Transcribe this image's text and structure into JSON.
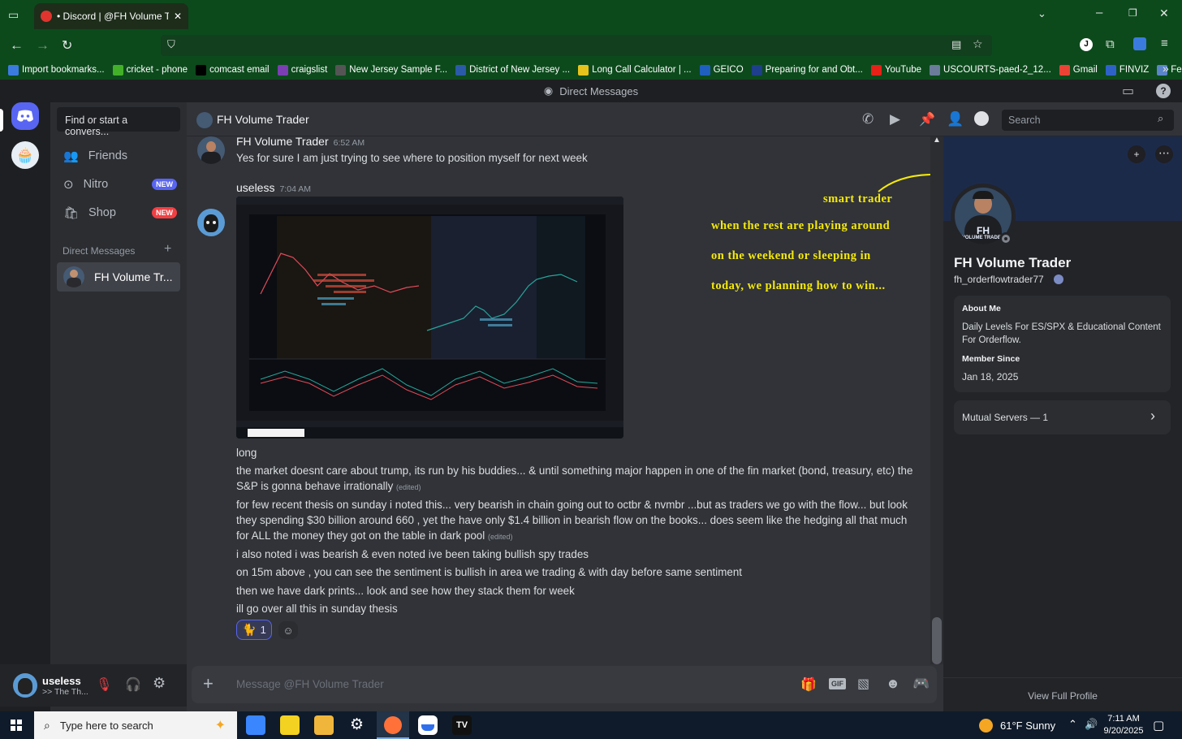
{
  "browser": {
    "tab_title": "• Discord | @FH Volume Trader",
    "bookmarks": [
      {
        "label": "Import bookmarks...",
        "color": "#3b7be0"
      },
      {
        "label": "cricket - phone",
        "color": "#43b02a"
      },
      {
        "label": "comcast email",
        "color": "#000000"
      },
      {
        "label": "craigslist",
        "color": "#7b3fb3"
      },
      {
        "label": "New Jersey Sample F...",
        "color": "#555555"
      },
      {
        "label": "District of New Jersey ...",
        "color": "#2b5aa8"
      },
      {
        "label": "Long Call Calculator | ...",
        "color": "#e8c21c"
      },
      {
        "label": "GEICO",
        "color": "#1f5fbf"
      },
      {
        "label": "Preparing for and Obt...",
        "color": "#1e3f8c"
      },
      {
        "label": "YouTube",
        "color": "#e62117"
      },
      {
        "label": "USCOURTS-paed-2_12...",
        "color": "#6a7c9a"
      },
      {
        "label": "Gmail",
        "color": "#ea4335"
      },
      {
        "label": "FINVIZ",
        "color": "#2f62c9"
      },
      {
        "label": "Feed | Utradea",
        "color": "#5b85c9"
      }
    ]
  },
  "discord": {
    "window_title": "Direct Messages",
    "find_placeholder": "Find or start a convers...",
    "nav": {
      "friends": "Friends",
      "nitro": "Nitro",
      "shop": "Shop",
      "new_badge": "NEW"
    },
    "dm_header": "Direct Messages",
    "dm_add": "+",
    "dm_items": [
      {
        "name": "FH Volume Tr..."
      }
    ],
    "user": {
      "name": "useless",
      "status": ">> The Th..."
    },
    "chat": {
      "title": "FH Volume Trader",
      "search_placeholder": "Search",
      "composer_placeholder": "Message @FH Volume Trader",
      "messages": [
        {
          "author": "FH Volume Trader",
          "time": "6:52 AM",
          "text": "Yes for sure I am just trying to see where to position myself for next week"
        },
        {
          "author": "useless",
          "time": "7:04 AM"
        }
      ],
      "followups": [
        {
          "text": "long",
          "edited": ""
        },
        {
          "text": "the market doesnt care about trump, its run by his buddies... & until something major happen in one of the fin market (bond, treasury, etc) the S&P is gonna behave irrationally",
          "edited": "(edited)"
        },
        {
          "text": "for few recent thesis on sunday i noted this... very bearish in chain going out to octbr & nvmbr ...but as traders we go with the flow... but look they spending $30 billion around 660 , yet the have only $1.4 billion in bearish flow on the books... does seem like the hedging all that much for ALL the money they got on the table in dark pool",
          "edited": "(edited)"
        },
        {
          "text": "i also noted i was bearish & even noted ive been taking bullish spy trades",
          "edited": ""
        },
        {
          "text": "on 15m above , you can see the sentiment is bullish in area we trading & with day before same sentiment",
          "edited": ""
        },
        {
          "text": "then we have dark prints... look and see how they stack them for week",
          "edited": ""
        },
        {
          "text": "ill go over all this in sunday thesis",
          "edited": ""
        }
      ],
      "reaction": {
        "emoji": "🐈",
        "count": "1"
      }
    },
    "annotation": {
      "line1": "smart trader",
      "line2": "when the rest are playing around",
      "line3": "on the weekend or sleeping in",
      "line4": "today, we planning how to win..."
    },
    "profile": {
      "display_name": "FH Volume Trader",
      "username": "fh_orderflowtrader77",
      "about_label": "About Me",
      "about_text": "Daily Levels For ES/SPX & Educational Content For Orderflow.",
      "member_since_label": "Member Since",
      "member_since": "Jan 18, 2025",
      "mutual_servers": "Mutual Servers — 1",
      "view_full": "View Full Profile",
      "avatar_text_top": "FH",
      "avatar_text_bottom": "VOLUME TRADER"
    }
  },
  "taskbar": {
    "search_placeholder": "Type here to search",
    "weather": "61°F  Sunny",
    "time": "7:11 AM",
    "date": "9/20/2025"
  }
}
